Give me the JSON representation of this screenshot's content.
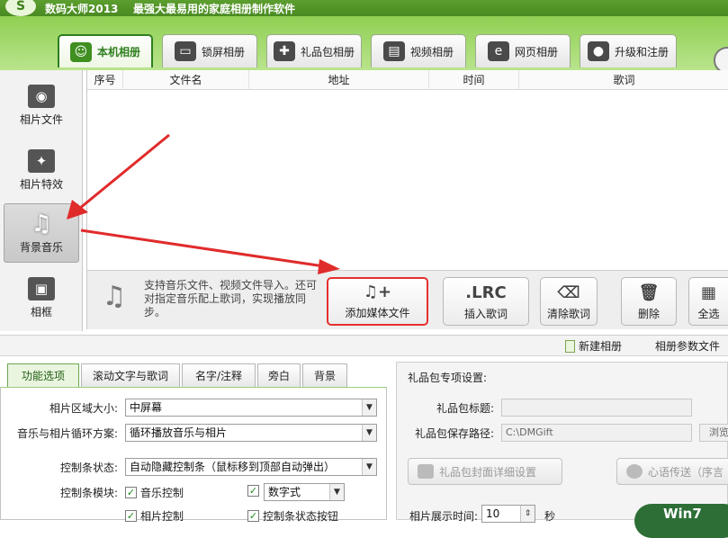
{
  "window": {
    "app_name": "数码大师2013",
    "slogan": "最强大最易用的家庭相册制作软件",
    "logo_text": "S"
  },
  "tabs": [
    {
      "label": "本机相册",
      "icon": "person-icon",
      "active": true
    },
    {
      "label": "锁屏相册",
      "icon": "monitor-icon",
      "active": false
    },
    {
      "label": "礼品包相册",
      "icon": "gift-icon",
      "active": false
    },
    {
      "label": "视频相册",
      "icon": "film-icon",
      "active": false
    },
    {
      "label": "网页相册",
      "icon": "ie-icon",
      "active": false
    },
    {
      "label": "升级和注册",
      "icon": "globe-icon",
      "active": false
    }
  ],
  "sidebar": {
    "items": [
      {
        "label": "相片文件",
        "icon": "camera-icon",
        "active": false
      },
      {
        "label": "相片特效",
        "icon": "sparkle-icon",
        "active": false
      },
      {
        "label": "背景音乐",
        "icon": "music-icon",
        "active": true
      },
      {
        "label": "相框",
        "icon": "picture-frame-icon",
        "active": false
      }
    ]
  },
  "table": {
    "columns": [
      "序号",
      "文件名",
      "地址",
      "时间",
      "歌词"
    ]
  },
  "toolbar": {
    "hint": "支持音乐文件、视频文件导入。还可对指定音乐配上歌词，实现播放同步。",
    "buttons": [
      {
        "label": "添加媒体文件",
        "icon": "add-music-icon",
        "icon_glyph": "♫+"
      },
      {
        "label": "插入歌词",
        "icon": "lrc-icon",
        "icon_glyph": ".LRC"
      },
      {
        "label": "清除歌词",
        "icon": "eraser-icon",
        "icon_glyph": "⌫"
      },
      {
        "label": "删除",
        "icon": "trash-icon",
        "icon_glyph": "🗑"
      },
      {
        "label": "全选",
        "icon": "grid-icon",
        "icon_glyph": "▦"
      }
    ]
  },
  "album_bar": {
    "new_album": "新建相册",
    "album_params": "相册参数文件"
  },
  "options_tabs": [
    "功能选项",
    "滚动文字与歌词",
    "名字/注释",
    "旁白",
    "背景"
  ],
  "options": {
    "photo_area_label": "相片区域大小:",
    "photo_area_value": "中屏幕",
    "loop_label": "音乐与相片循环方案:",
    "loop_value": "循环播放音乐与相片",
    "control_state_label": "控制条状态:",
    "control_state_value": "自动隐藏控制条（鼠标移到顶部自动弹出）",
    "control_module_label": "控制条模块:",
    "chk_music": "音乐控制",
    "chk_digital": "数字式",
    "chk_photo": "相片控制",
    "chk_state": "控制条状态按钮"
  },
  "gift": {
    "title": "礼品包专项设置:",
    "title_label": "礼品包标题:",
    "title_value": "",
    "path_label": "礼品包保存路径:",
    "path_value": "C:\\DMGift",
    "browse": "浏览",
    "cover_btn": "礼品包封面详细设置",
    "heart_btn": "心语传送（序言",
    "display_time_label": "相片展示时间:",
    "display_time_value": "10",
    "display_time_unit": "秒"
  },
  "watermark": "Win7"
}
